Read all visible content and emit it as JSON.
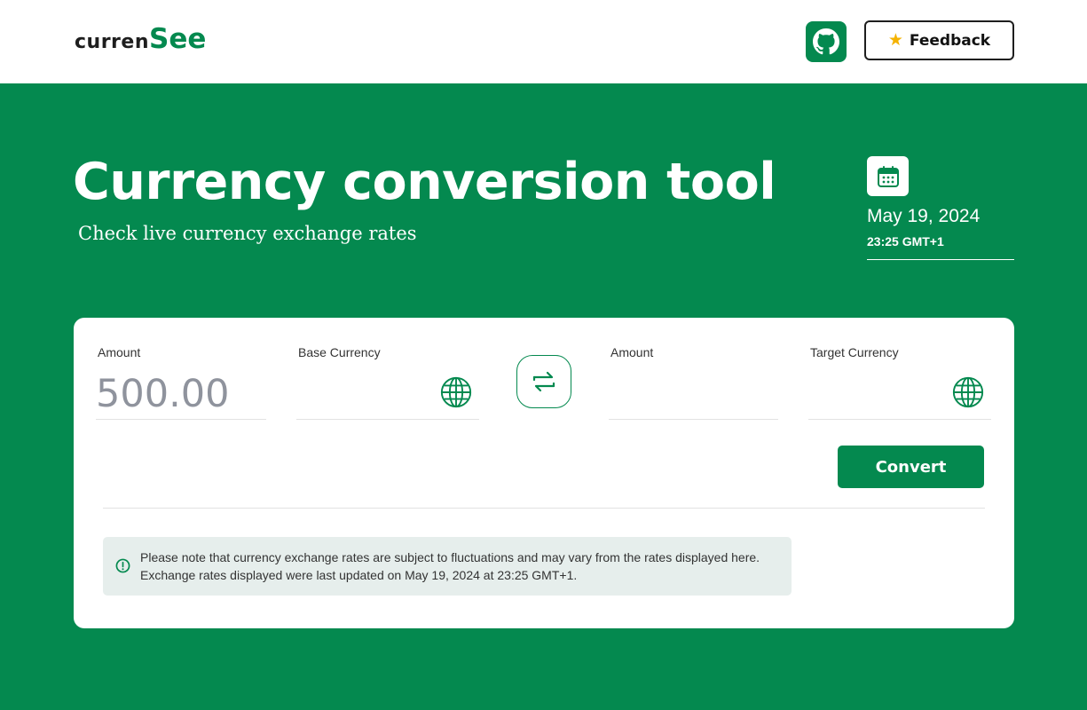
{
  "header": {
    "logo_part1": "curren",
    "logo_part2": "See",
    "feedback_label": "Feedback"
  },
  "hero": {
    "title": "Currency conversion tool",
    "subtitle": "Check live currency exchange rates"
  },
  "datetime": {
    "date": "May 19, 2024",
    "time": "23:25 GMT+1"
  },
  "converter": {
    "amount_label": "Amount",
    "amount_placeholder": "500.00",
    "base_currency_label": "Base Currency",
    "target_amount_label": "Amount",
    "target_currency_label": "Target Currency",
    "convert_label": "Convert"
  },
  "notice": {
    "line1": "Please note that currency exchange rates are subject to fluctuations and may vary from the rates displayed here.",
    "line2": "Exchange rates displayed were last updated on May 19, 2024 at 23:25 GMT+1."
  },
  "colors": {
    "brand_green": "#04894f",
    "star": "#f5b301"
  }
}
